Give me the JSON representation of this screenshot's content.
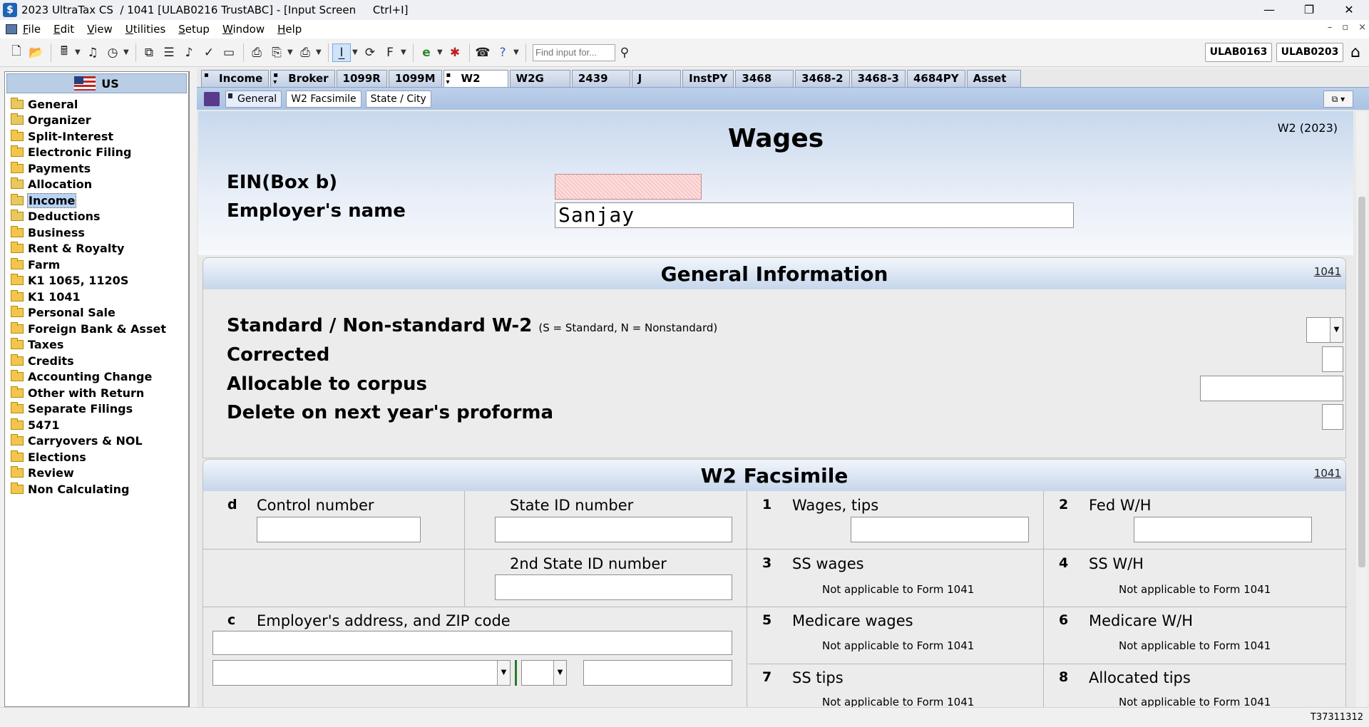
{
  "window": {
    "title": "2023 UltraTax CS  / 1041 [ULAB0216 TrustABC] - [Input Screen     Ctrl+I]",
    "controls": [
      "—",
      "❐",
      "✕"
    ]
  },
  "menu": {
    "items": [
      {
        "key": "F",
        "rest": "ile"
      },
      {
        "key": "E",
        "rest": "dit"
      },
      {
        "key": "V",
        "rest": "iew"
      },
      {
        "key": "U",
        "rest": "tilities"
      },
      {
        "key": "S",
        "rest": "etup"
      },
      {
        "key": "W",
        "rest": "indow"
      },
      {
        "key": "H",
        "rest": "elp"
      }
    ],
    "mdi_controls": [
      "–",
      "▫",
      "×"
    ]
  },
  "toolbar": {
    "find_placeholder": "Find input for...",
    "client_buttons": [
      "ULAB0163",
      "ULAB0203"
    ]
  },
  "sidebar": {
    "header": "US",
    "items": [
      "General",
      "Organizer",
      "Split-Interest",
      "Electronic Filing",
      "Payments",
      "Allocation",
      "Income",
      "Deductions",
      "Business",
      "Rent & Royalty",
      "Farm",
      "K1 1065, 1120S",
      "K1 1041",
      "Personal Sale",
      "Foreign Bank & Asset",
      "Taxes",
      "Credits",
      "Accounting Change",
      "Other with Return",
      "Separate Filings",
      "5471",
      "Carryovers & NOL",
      "Elections",
      "Review",
      "Non Calculating"
    ],
    "selected": "Income"
  },
  "tabs": [
    "Income",
    "Broker",
    "1099R",
    "1099M",
    "W2",
    "W2G",
    "2439",
    "J",
    "InstPY",
    "3468",
    "3468-2",
    "3468-3",
    "4684PY",
    "Asset"
  ],
  "active_tab": "W2",
  "subtabs": [
    "General",
    "W2 Facsimile",
    "State / City"
  ],
  "active_subtab": "General",
  "form": {
    "title": "Wages",
    "form_ref": "W2 (2023)",
    "ein_label": "EIN(Box b)",
    "ein_value": "",
    "employer_label": "Employer's name",
    "employer_value": "Sanjay"
  },
  "general_info": {
    "title": "General Information",
    "link": "1041",
    "standard_label": "Standard / Non-standard W-2",
    "standard_hint": "(S = Standard, N = Nonstandard)",
    "corrected_label": "Corrected",
    "allocable_label": "Allocable to corpus",
    "delete_label": "Delete on next year's proforma"
  },
  "facsimile": {
    "title": "W2 Facsimile",
    "link": "1041",
    "d_code": "d",
    "control_number": "Control number",
    "state_id": "State ID number",
    "state_id2": "2nd State ID number",
    "c_code": "c",
    "address_label": "Employer's address, and ZIP code",
    "boxes": [
      {
        "num": "1",
        "label": "Wages, tips",
        "na": ""
      },
      {
        "num": "2",
        "label": "Fed W/H",
        "na": ""
      },
      {
        "num": "3",
        "label": "SS wages",
        "na": "Not applicable to Form 1041"
      },
      {
        "num": "4",
        "label": "SS W/H",
        "na": "Not applicable to Form 1041"
      },
      {
        "num": "5",
        "label": "Medicare wages",
        "na": "Not applicable to Form 1041"
      },
      {
        "num": "6",
        "label": "Medicare W/H",
        "na": "Not applicable to Form 1041"
      },
      {
        "num": "7",
        "label": "SS tips",
        "na": "Not applicable to Form 1041"
      },
      {
        "num": "8",
        "label": "Allocated tips",
        "na": "Not applicable to Form 1041"
      }
    ]
  },
  "status": {
    "session_id": "T37311312"
  }
}
